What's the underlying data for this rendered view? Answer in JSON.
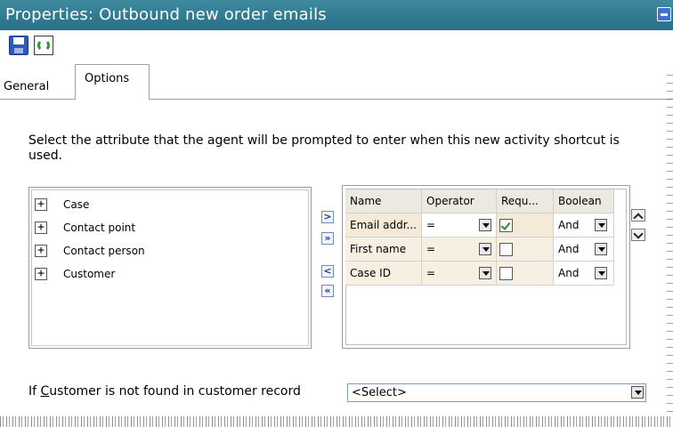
{
  "window": {
    "title": "Properties: Outbound new order emails"
  },
  "toolbar": {
    "save_icon": "save-icon",
    "refresh_icon": "refresh-icon"
  },
  "tabs": [
    {
      "label": "General",
      "active": false
    },
    {
      "label": "Options",
      "active": true
    }
  ],
  "instructions": "Select the attribute that the agent will be prompted to enter when this new activity shortcut is used.",
  "attributes": [
    {
      "label": "Case"
    },
    {
      "label": "Contact point"
    },
    {
      "label": "Contact person"
    },
    {
      "label": "Customer"
    }
  ],
  "move_buttons": {
    "add": ">",
    "add_all": "»",
    "remove": "<",
    "remove_all": "«"
  },
  "grid": {
    "headers": [
      "Name",
      "Operator",
      "Requ...",
      "Boolean"
    ],
    "rows": [
      {
        "name": "Email addr...",
        "operator": "=",
        "required": true,
        "boolean": "And"
      },
      {
        "name": "First name",
        "operator": "=",
        "required": false,
        "boolean": "And"
      },
      {
        "name": "Case ID",
        "operator": "=",
        "required": false,
        "boolean": "And"
      }
    ]
  },
  "footer": {
    "label_prefix": "If ",
    "label_underlined": "C",
    "label_rest": "ustomer is not found in customer record",
    "select_value": "<Select>"
  },
  "colors": {
    "title_bar": "#2f7a90",
    "grid_header": "#ece9e1",
    "row_fill": "#f7efe1"
  }
}
